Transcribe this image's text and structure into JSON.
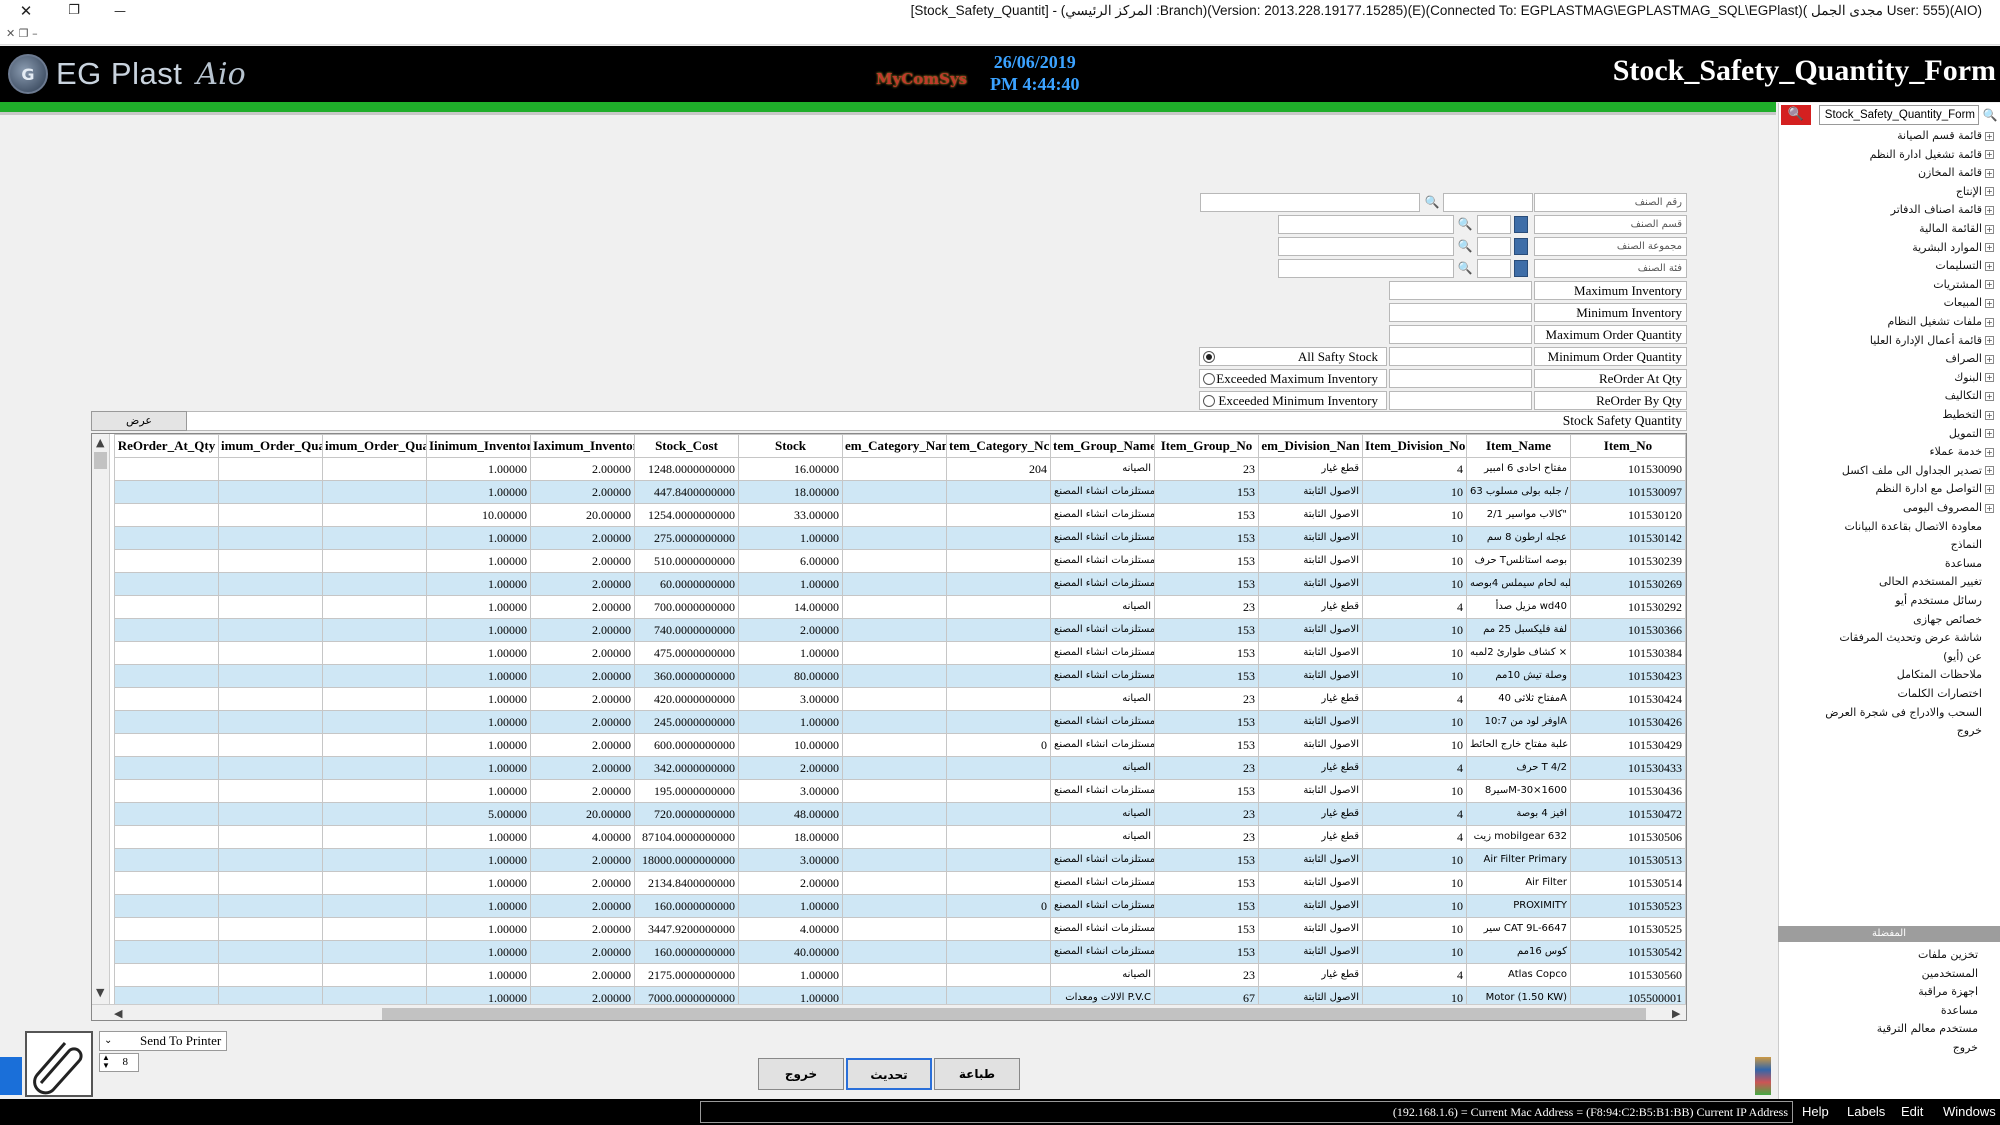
{
  "window": {
    "title": "[Stock_Safety_Quantit] - (المركز الرئيسي :Branch)(Version: 2013.228.19177.15285)(E)(Connected To: EGPLASTMAG\\EGPLASTMAG_SQL\\EGPlast)( مجدى الجمل User: 555)(AIO)",
    "close_glyph": "✕",
    "restore_glyph": "❐",
    "minimize_glyph": "—"
  },
  "header": {
    "logo_text": "EG Plast",
    "logo_sig": "Aio",
    "mycomsys": "MyComSys",
    "date": "26/06/2019",
    "time": "PM 4:44:40",
    "form_title": "Stock_Safety_Quantity_Form"
  },
  "sidebar": {
    "search_value": "Stock_Safety_Quantity_Form",
    "items": [
      "قائمة قسم الصيانة",
      "قائمة تشغيل ادارة النظم",
      "قائمة المخازن",
      "الإنتاج",
      "قائمة اصناف الدفاتر",
      "القائمة المالية",
      "الموارد البشرية",
      "التسليمات",
      "المشتريات",
      "المبيعات",
      "ملفات تشغيل النظام",
      "قائمة أعمال الإدارة العليا",
      "الصراف",
      "البنوك",
      "التكاليف",
      "التخطيط",
      "التمويل",
      "خدمة عملاء",
      "تصدير الجداول الى ملف اكسل",
      "التواصل مع ادارة النظم",
      "المصروف اليومى"
    ],
    "items_plain": [
      "معاودة الاتصال بقاعدة البيانات",
      "النماذج",
      "مساعدة",
      "تغيير المستخدم الحالى",
      "رسائل مستخدم أيو",
      "خصائص جهازى",
      "شاشة عرض وتحديث المرفقات",
      "عن (أيو)",
      "ملاحظات المتكامل",
      "اختصارات الكلمات",
      "السحب والادراج فى شجرة العرض",
      "خروج"
    ],
    "section_title": "المفضلة",
    "fav_items": [
      "تخزين ملفات",
      "المستخدمين",
      "اجهزة مراقبة",
      "مساعدة",
      "مستخدم معالم الترقية",
      "خروج"
    ]
  },
  "filters": {
    "item_no": "رقم الصنف",
    "item_division": "قسم الصنف",
    "item_group": "مجموعة الصنف",
    "item_category": "فئة الصنف",
    "max_inventory": "Maximum Inventory",
    "min_inventory": "Minimum Inventory",
    "max_order_qty": "Maximum Order Quantity",
    "min_order_qty": "Minimum Order Quantity",
    "reorder_at_qty": "ReOrder At Qty",
    "reorder_by_qty": "ReOrder By Qty",
    "radio_all": "All Safty Stock",
    "radio_exceeded_max": "Exceeded Maximum Inventory",
    "radio_exceeded_min": "Exceeded Minimum Inventory",
    "view_button": "عرض",
    "ssq_label": "Stock Safety Quantity"
  },
  "grid": {
    "columns": [
      "ReOrder_At_Qty",
      "imum_Order_Quai",
      "imum_Order_Quai",
      "Iinimum_Inventor",
      "Iaximum_Inventor",
      "Stock_Cost",
      "Stock",
      "em_Category_Nan",
      "tem_Category_Nc",
      "tem_Group_Name",
      "Item_Group_No",
      "em_Division_Nan",
      "Item_Division_No",
      "Item_Name",
      "Item_No"
    ],
    "rows": [
      [
        "",
        "",
        "",
        "1.00000",
        "2.00000",
        "1248.0000000000",
        "16.00000",
        "",
        "204",
        "الصيانه",
        "23",
        "قطع غيار",
        "4",
        "مفتاح احادى 6 امبير",
        "101530090"
      ],
      [
        "",
        "",
        "",
        "1.00000",
        "2.00000",
        "447.8400000000",
        "18.00000",
        "",
        "",
        "مستلزمات انشاء المصنع",
        "153",
        "الاصول الثابتة",
        "10",
        "جلبه بولى مسلوب 63 /",
        "101530097"
      ],
      [
        "",
        "",
        "",
        "10.00000",
        "20.00000",
        "1254.0000000000",
        "33.00000",
        "",
        "",
        "مستلزمات انشاء المصنع",
        "153",
        "الاصول الثابتة",
        "10",
        "كالاب مواسير 2/1\"",
        "101530120"
      ],
      [
        "",
        "",
        "",
        "1.00000",
        "2.00000",
        "275.0000000000",
        "1.00000",
        "",
        "",
        "مستلزمات انشاء المصنع",
        "153",
        "الاصول الثابتة",
        "10",
        "عجله ارطون 8 سم",
        "101530142"
      ],
      [
        "",
        "",
        "",
        "1.00000",
        "2.00000",
        "510.0000000000",
        "6.00000",
        "",
        "",
        "مستلزمات انشاء المصنع",
        "153",
        "الاصول الثابتة",
        "10",
        "حرف Tبوصه استانلس",
        "101530239"
      ],
      [
        "",
        "",
        "",
        "1.00000",
        "2.00000",
        "60.0000000000",
        "1.00000",
        "",
        "",
        "مستلزمات انشاء المصنع",
        "153",
        "الاصول الثابتة",
        "10",
        "جلبه لحام سيملس 4بوصه",
        "101530269"
      ],
      [
        "",
        "",
        "",
        "1.00000",
        "2.00000",
        "700.0000000000",
        "14.00000",
        "",
        "",
        "الصيانه",
        "23",
        "قطع غيار",
        "4",
        "مزيل صدأ wd40",
        "101530292"
      ],
      [
        "",
        "",
        "",
        "1.00000",
        "2.00000",
        "740.0000000000",
        "2.00000",
        "",
        "",
        "مستلزمات انشاء المصنع",
        "153",
        "الاصول الثابتة",
        "10",
        "لفة فليكسبل 25 مم",
        "101530366"
      ],
      [
        "",
        "",
        "",
        "1.00000",
        "2.00000",
        "475.0000000000",
        "1.00000",
        "",
        "",
        "مستلزمات انشاء المصنع",
        "153",
        "الاصول الثابتة",
        "10",
        "كشاف طوارئ 2لمبه ×",
        "101530384"
      ],
      [
        "",
        "",
        "",
        "1.00000",
        "2.00000",
        "360.0000000000",
        "80.00000",
        "",
        "",
        "مستلزمات انشاء المصنع",
        "153",
        "الاصول الثابتة",
        "10",
        "وصلة تيش 10مم",
        "101530423"
      ],
      [
        "",
        "",
        "",
        "1.00000",
        "2.00000",
        "420.0000000000",
        "3.00000",
        "",
        "",
        "الصيانه",
        "23",
        "قطع غيار",
        "4",
        "مفتاح ثلاثى 40A",
        "101530424"
      ],
      [
        "",
        "",
        "",
        "1.00000",
        "2.00000",
        "245.0000000000",
        "1.00000",
        "",
        "",
        "مستلزمات انشاء المصنع",
        "153",
        "الاصول الثابتة",
        "10",
        "اوفر لود من 10:7A",
        "101530426"
      ],
      [
        "",
        "",
        "",
        "1.00000",
        "2.00000",
        "600.0000000000",
        "10.00000",
        "",
        "0",
        "مستلزمات انشاء المصنع",
        "153",
        "الاصول الثابتة",
        "10",
        "علبة مفتاح خارج الحائط",
        "101530429"
      ],
      [
        "",
        "",
        "",
        "1.00000",
        "2.00000",
        "342.0000000000",
        "2.00000",
        "",
        "",
        "الصيانه",
        "23",
        "قطع غيار",
        "4",
        "حرف T 4/2",
        "101530433"
      ],
      [
        "",
        "",
        "",
        "1.00000",
        "2.00000",
        "195.0000000000",
        "3.00000",
        "",
        "",
        "مستلزمات انشاء المصنع",
        "153",
        "الاصول الثابتة",
        "10",
        "سير8M-30×1600",
        "101530436"
      ],
      [
        "",
        "",
        "",
        "5.00000",
        "20.00000",
        "720.0000000000",
        "48.00000",
        "",
        "",
        "الصيانه",
        "23",
        "قطع غيار",
        "4",
        "افيز 4 بوصة",
        "101530472"
      ],
      [
        "",
        "",
        "",
        "1.00000",
        "4.00000",
        "87104.0000000000",
        "18.00000",
        "",
        "",
        "الصيانه",
        "23",
        "قطع غيار",
        "4",
        "زيت mobilgear 632",
        "101530506"
      ],
      [
        "",
        "",
        "",
        "1.00000",
        "2.00000",
        "18000.0000000000",
        "3.00000",
        "",
        "",
        "مستلزمات انشاء المصنع",
        "153",
        "الاصول الثابتة",
        "10",
        "Air Filter Primary",
        "101530513"
      ],
      [
        "",
        "",
        "",
        "1.00000",
        "2.00000",
        "2134.8400000000",
        "2.00000",
        "",
        "",
        "مستلزمات انشاء المصنع",
        "153",
        "الاصول الثابتة",
        "10",
        "Air Filter",
        "101530514"
      ],
      [
        "",
        "",
        "",
        "1.00000",
        "2.00000",
        "160.0000000000",
        "1.00000",
        "",
        "0",
        "مستلزمات انشاء المصنع",
        "153",
        "الاصول الثابتة",
        "10",
        "PROXIMITY",
        "101530523"
      ],
      [
        "",
        "",
        "",
        "1.00000",
        "2.00000",
        "3447.9200000000",
        "4.00000",
        "",
        "",
        "مستلزمات انشاء المصنع",
        "153",
        "الاصول الثابتة",
        "10",
        "سير CAT 9L-6647",
        "101530525"
      ],
      [
        "",
        "",
        "",
        "1.00000",
        "2.00000",
        "160.0000000000",
        "40.00000",
        "",
        "",
        "مستلزمات انشاء المصنع",
        "153",
        "الاصول الثابتة",
        "10",
        "كوس 16مم",
        "101530542"
      ],
      [
        "",
        "",
        "",
        "1.00000",
        "2.00000",
        "2175.0000000000",
        "1.00000",
        "",
        "",
        "الصيانه",
        "23",
        "قطع غيار",
        "4",
        "Atlas Copco",
        "101530560"
      ],
      [
        "",
        "",
        "",
        "1.00000",
        "2.00000",
        "7000.0000000000",
        "1.00000",
        "",
        "",
        "الالات ومعدات P.V.C",
        "67",
        "الاصول الثابتة",
        "10",
        "Motor (1.50 KW)",
        "105500001"
      ]
    ]
  },
  "bottom": {
    "exit_button": "خروج",
    "refresh_button": "تحديث",
    "print_button": "طباعة",
    "printer_select": "Send To Printer",
    "copies": "8"
  },
  "status": {
    "ip_text": "(192.168.1.6) = Current Mac Address = (F8:94:C2:B5:B1:BB) Current IP Address",
    "menus": [
      "Help",
      "Labels",
      "Edit",
      "Windows"
    ]
  }
}
